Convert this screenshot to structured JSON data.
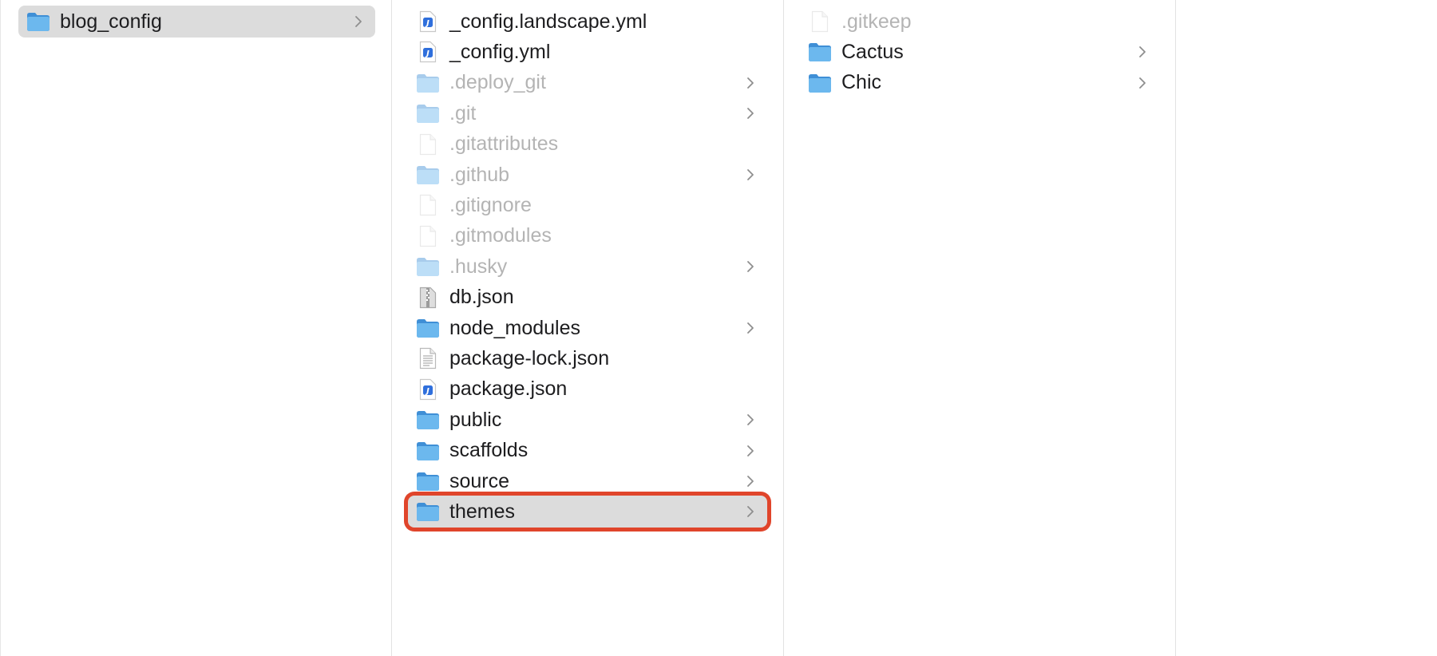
{
  "columns": [
    {
      "id": "col1",
      "items": [
        {
          "name": "blog_config",
          "kind": "folder",
          "hidden": false,
          "chevron": true,
          "selected": true
        }
      ]
    },
    {
      "id": "col2",
      "items": [
        {
          "name": "_config.landscape.yml",
          "kind": "script",
          "hidden": false,
          "chevron": false
        },
        {
          "name": "_config.yml",
          "kind": "script",
          "hidden": false,
          "chevron": false
        },
        {
          "name": ".deploy_git",
          "kind": "folder",
          "hidden": true,
          "chevron": true
        },
        {
          "name": ".git",
          "kind": "folder",
          "hidden": true,
          "chevron": true
        },
        {
          "name": ".gitattributes",
          "kind": "file",
          "hidden": true,
          "chevron": false
        },
        {
          "name": ".github",
          "kind": "folder",
          "hidden": true,
          "chevron": true
        },
        {
          "name": ".gitignore",
          "kind": "file",
          "hidden": true,
          "chevron": false
        },
        {
          "name": ".gitmodules",
          "kind": "file",
          "hidden": true,
          "chevron": false
        },
        {
          "name": ".husky",
          "kind": "folder",
          "hidden": true,
          "chevron": true
        },
        {
          "name": "db.json",
          "kind": "archive",
          "hidden": false,
          "chevron": false
        },
        {
          "name": "node_modules",
          "kind": "folder",
          "hidden": false,
          "chevron": true
        },
        {
          "name": "package-lock.json",
          "kind": "document",
          "hidden": false,
          "chevron": false
        },
        {
          "name": "package.json",
          "kind": "script",
          "hidden": false,
          "chevron": false
        },
        {
          "name": "public",
          "kind": "folder",
          "hidden": false,
          "chevron": true
        },
        {
          "name": "scaffolds",
          "kind": "folder",
          "hidden": false,
          "chevron": true
        },
        {
          "name": "source",
          "kind": "folder",
          "hidden": false,
          "chevron": true
        },
        {
          "name": "themes",
          "kind": "folder",
          "hidden": false,
          "chevron": true,
          "selected": true,
          "highlighted": true
        }
      ]
    },
    {
      "id": "col3",
      "items": [
        {
          "name": ".gitkeep",
          "kind": "file",
          "hidden": true,
          "chevron": false
        },
        {
          "name": "Cactus",
          "kind": "folder",
          "hidden": false,
          "chevron": true
        },
        {
          "name": "Chic",
          "kind": "folder",
          "hidden": false,
          "chevron": true
        }
      ]
    },
    {
      "id": "col4",
      "items": []
    }
  ],
  "colors": {
    "selection_background": "#dcdcdc",
    "highlight_outline": "#e0452b",
    "folder_blue": "#5aa9e6",
    "hidden_text": "#b4b4b4"
  }
}
